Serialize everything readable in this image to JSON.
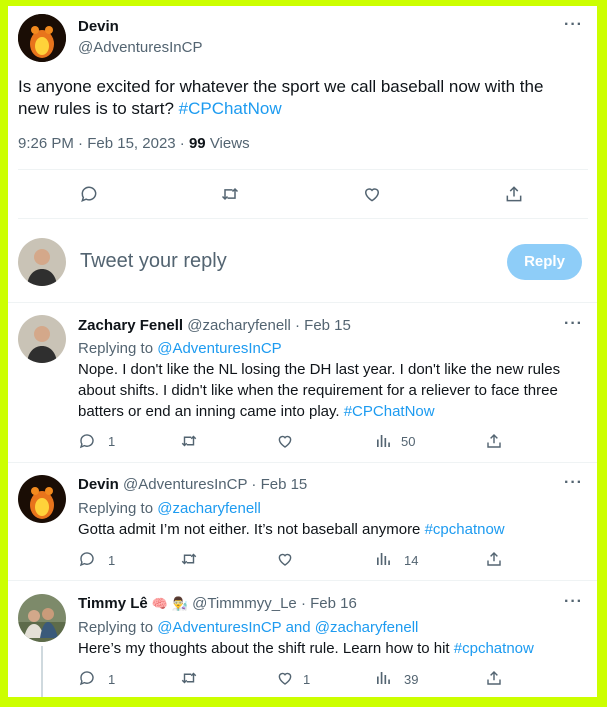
{
  "main_tweet": {
    "author_name": "Devin",
    "author_handle": "@AdventuresInCP",
    "text_before_link": "Is anyone excited for whatever the sport we call baseball now with the new rules is to start? ",
    "hashtag": "#CPChatNow",
    "time": "9:26 PM",
    "date": "Feb 15, 2023",
    "views_count": "99",
    "views_label": "Views"
  },
  "reply_box": {
    "placeholder": "Tweet your reply",
    "button_label": "Reply"
  },
  "replies": [
    {
      "author_name": "Zachary Fenell",
      "author_handle": "@zacharyfenell",
      "date": "Feb 15",
      "replying_to_label": "Replying to ",
      "replying_to": "@AdventuresInCP",
      "text": "Nope. I don't like the NL losing the DH last year. I don't like the new rules about shifts. I didn't like when the requirement for a reliever to face three batters or end an inning came into play. ",
      "hashtag": "#CPChatNow",
      "reply_count": "1",
      "retweet_count": "",
      "like_count": "",
      "views_count": "50"
    },
    {
      "author_name": "Devin",
      "author_handle": "@AdventuresInCP",
      "date": "Feb 15",
      "replying_to_label": "Replying to ",
      "replying_to": "@zacharyfenell",
      "text": "Gotta admit I’m not either. It’s not baseball anymore ",
      "hashtag": "#cpchatnow",
      "reply_count": "1",
      "retweet_count": "",
      "like_count": "",
      "views_count": "14"
    },
    {
      "author_name": "Timmy Lê",
      "author_emoji": "🧠 👨‍🔬",
      "author_handle": "@Timmmyy_Le",
      "date": "Feb 16",
      "replying_to_label": "Replying to ",
      "replying_to": "@AdventuresInCP and @zacharyfenell",
      "text": "Here’s my thoughts about the shift rule. Learn how to hit ",
      "hashtag": "#cpchatnow",
      "reply_count": "1",
      "retweet_count": "",
      "like_count": "1",
      "views_count": "39"
    }
  ],
  "colors": {
    "border": "#ccff00",
    "link": "#1d9bf0",
    "muted": "#536471",
    "reply_button": "#8ecdf8"
  },
  "icons": [
    "more-icon",
    "reply-icon",
    "retweet-icon",
    "like-icon",
    "share-icon",
    "views-icon"
  ]
}
